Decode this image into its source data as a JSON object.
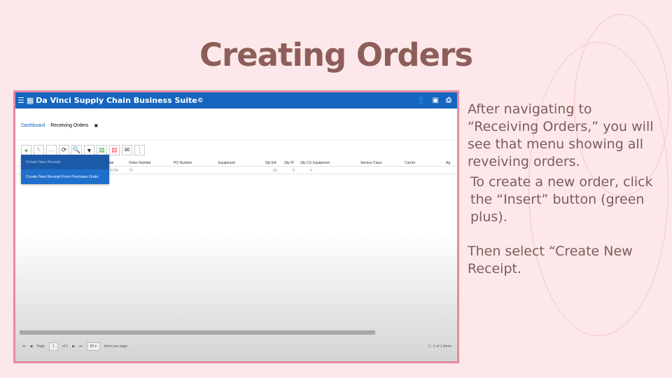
{
  "slide": {
    "title": "Creating Orders",
    "paragraphs": [
      "After navigating to “Receiving Orders,” you will see that menu showing all reveiving orders.",
      "To create a new order, click the “Insert” button (green plus).",
      "Then select “Create New Receipt."
    ]
  },
  "app": {
    "title": "Da Vinci Supply Chain Business Suite",
    "title_mark": "©",
    "tabs": [
      {
        "label": "Dashboard"
      },
      {
        "label": "Receiving Orders"
      }
    ],
    "toolbar": {
      "insert": "+",
      "edit": "✎",
      "delete": "—",
      "refresh": "⟳",
      "search": "🔍",
      "filter": "▼",
      "excel": "▤",
      "pdf": "▤",
      "email": "✉",
      "more": "⋮"
    },
    "columns": [
      "Date",
      "Order Number",
      "PO Number",
      "Equipment",
      "Qty EA",
      "Qty IP",
      "Qty CS",
      "Equipment",
      "Service Class",
      "Carrier",
      "Ag"
    ],
    "row": {
      "date": "7:16 PM",
      "order_number": "75",
      "qty_ea": "10",
      "qty_ip": "0",
      "qty_cs": "0"
    },
    "menu": [
      "Create New Receipt",
      "Create New Receipt From Purchase Order"
    ],
    "pager": {
      "page_label": "Page",
      "page": "1",
      "of": "of 1",
      "page_size": "50",
      "per_page": "items per page",
      "summary": "1 - 1 of 1 items"
    }
  },
  "colors": {
    "header": "#1565c0",
    "title": "#8d5e58",
    "frame": "#e68aa0"
  }
}
